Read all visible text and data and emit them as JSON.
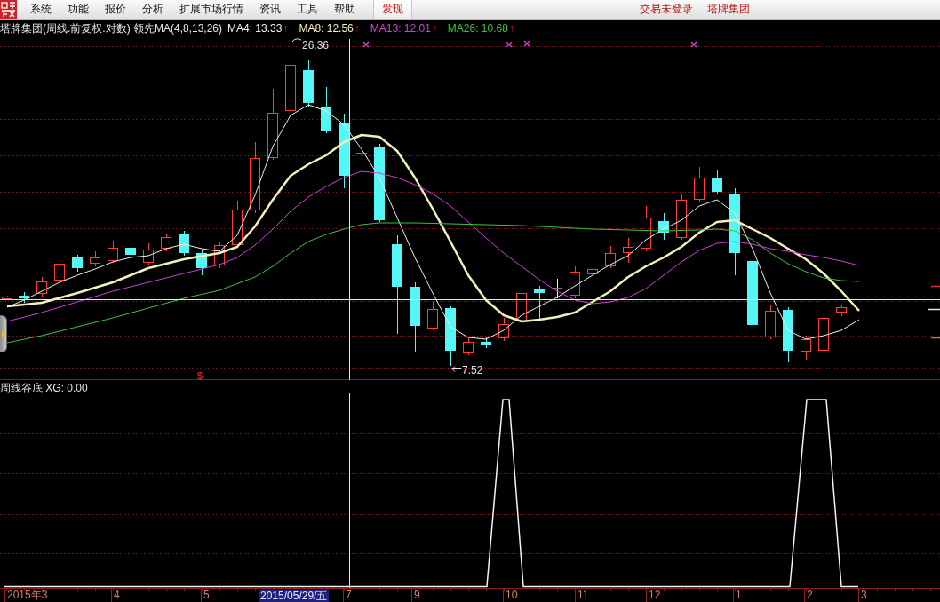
{
  "menu_bar": {
    "items": [
      {
        "label": "系统",
        "highlighted": false
      },
      {
        "label": "功能",
        "highlighted": false
      },
      {
        "label": "报价",
        "highlighted": false
      },
      {
        "label": "分析",
        "highlighted": false
      },
      {
        "label": "扩展市场行情",
        "highlighted": false
      },
      {
        "label": "资讯",
        "highlighted": false
      },
      {
        "label": "工具",
        "highlighted": false
      },
      {
        "label": "帮助",
        "highlighted": false
      },
      {
        "label": "发现",
        "highlighted": true
      }
    ],
    "trade_status": "交易未登录",
    "account": "塔牌集团"
  },
  "main_chart": {
    "title": "塔牌集团(周线.前复权.对数) 领先MA(4,8,13,26)",
    "indicators": [
      {
        "label": "MA4: 13.33",
        "arrow": "↑",
        "color": "#f0f0f0"
      },
      {
        "label": "MA8: 12.56",
        "arrow": "↑",
        "color": "#f4f0b8"
      },
      {
        "label": "MA13: 12.01",
        "arrow": "↑",
        "color": "#d040d8"
      },
      {
        "label": "MA26: 10.68",
        "arrow": "↑",
        "color": "#40c040"
      }
    ],
    "high_label": "26.36",
    "low_label": "7.52",
    "signal_marker": "$"
  },
  "sub_chart": {
    "title": "周线谷底 XG: 0.00"
  },
  "x_axis": {
    "labels": [
      "2015年3",
      "4",
      "5",
      "7",
      "9",
      "10",
      "11",
      "12",
      "1",
      "2",
      "3"
    ],
    "cursor_date": "2015/05/29/五"
  }
}
